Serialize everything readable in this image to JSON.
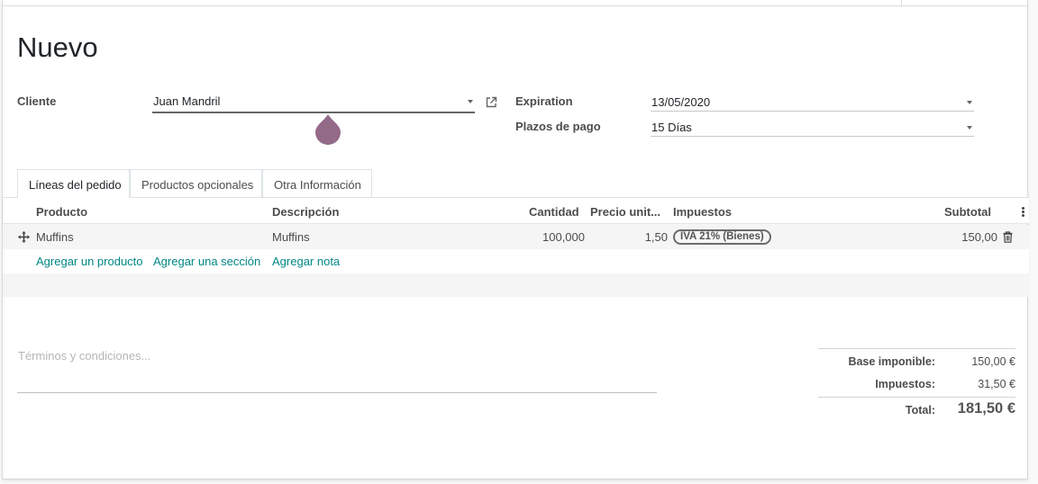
{
  "record": {
    "title": "Nuevo"
  },
  "customer": {
    "label": "Cliente",
    "value": "Juan Mandril"
  },
  "expiration": {
    "label": "Expiration",
    "value": "13/05/2020"
  },
  "payment_terms": {
    "label": "Plazos de pago",
    "value": "15 Días"
  },
  "tabs": [
    {
      "label": "Líneas del pedido",
      "active": true
    },
    {
      "label": "Productos opcionales",
      "active": false
    },
    {
      "label": "Otra Información",
      "active": false
    }
  ],
  "table": {
    "headers": {
      "product": "Producto",
      "description": "Descripción",
      "quantity": "Cantidad",
      "unit_price": "Precio unit...",
      "taxes": "Impuestos",
      "subtotal": "Subtotal"
    },
    "rows": [
      {
        "product": "Muffins",
        "description": "Muffins",
        "quantity": "100,000",
        "unit_price": "1,50",
        "tax_badge": "IVA 21% (Bienes)",
        "subtotal": "150,00"
      }
    ],
    "actions": {
      "add_product": "Agregar un producto",
      "add_section": "Agregar una sección",
      "add_note": "Agregar nota"
    }
  },
  "terms": {
    "placeholder": "Términos y condiciones..."
  },
  "totals": {
    "base_label": "Base imponible:",
    "base_value": "150,00 €",
    "tax_label": "Impuestos:",
    "tax_value": "31,50 €",
    "total_label": "Total:",
    "total_value": "181,50 €"
  },
  "icons": {
    "external_link": "external-link-icon",
    "drag_handle": "drag-handle-icon",
    "trash": "trash-icon",
    "kebab": "kebab-menu-icon",
    "dropdown_caret": "chevron-down-icon"
  },
  "colors": {
    "link": "#008784",
    "accent_drop": "#875a7b"
  }
}
